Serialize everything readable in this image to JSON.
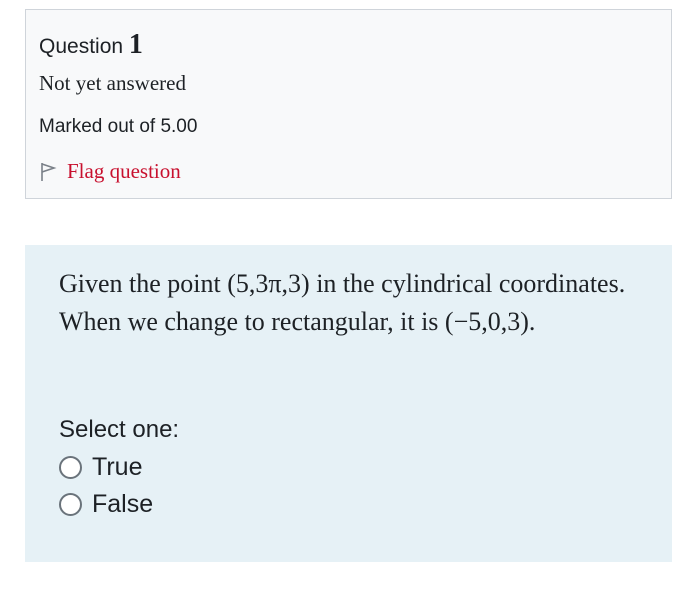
{
  "info": {
    "question_word": "Question",
    "question_number": "1",
    "state": "Not yet answered",
    "grade": "Marked out of 5.00",
    "flag_label": "Flag question",
    "flag_icon": "flag-outline-icon",
    "flag_color": "#c8102e"
  },
  "question": {
    "text": "Given the point (5,3π,3) in the cylindrical coordinates. When we change to rectangular, it is (−5,0,3).",
    "prompt": "Select one:",
    "options": [
      {
        "label": "True",
        "selected": false
      },
      {
        "label": "False",
        "selected": false
      }
    ]
  },
  "colors": {
    "info_background": "#f8f9fa",
    "question_background": "#e6f1f6"
  }
}
